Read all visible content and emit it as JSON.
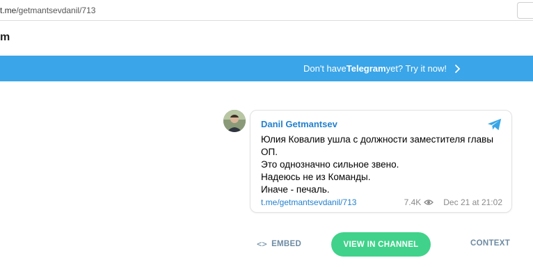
{
  "browser": {
    "url_host": "t.me",
    "url_path": "/getmantsevdanil/713"
  },
  "header": {
    "logo_fragment": "m"
  },
  "banner": {
    "prefix": "Don't have ",
    "brand": "Telegram",
    "suffix": " yet? Try it now!",
    "background": "#3aa5e8"
  },
  "post": {
    "author": "Danil Getmantsev",
    "lines": [
      "Юлия Ковалив ушла с должности заместителя главы",
      "ОП.",
      "Это однозначно сильное звено.",
      "Надеюсь не из Команды.",
      "Иначе - печаль."
    ],
    "link": "t.me/getmantsevdanil/713",
    "views": "7.4K",
    "date": "Dec 21 at 21:02",
    "accent": "#2481cc"
  },
  "actions": {
    "embed_icon": "<>",
    "embed": "EMBED",
    "view_in_channel": "VIEW IN CHANNEL",
    "context": "CONTEXT",
    "button_color": "#40d28a"
  }
}
